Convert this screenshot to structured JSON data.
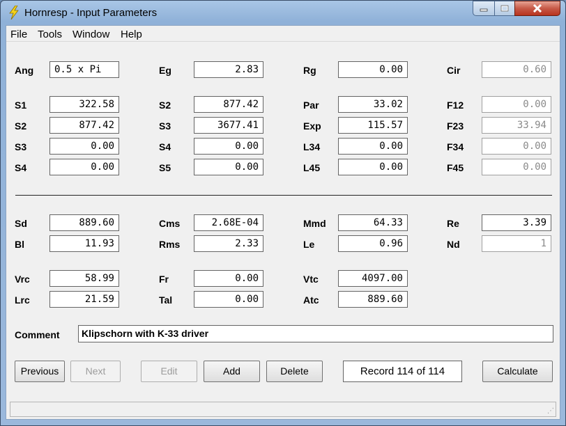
{
  "window": {
    "title": "Hornresp - Input Parameters"
  },
  "menu": {
    "file": "File",
    "tools": "Tools",
    "window": "Window",
    "help": "Help"
  },
  "fields": {
    "ang": {
      "label": "Ang",
      "value": "0.5 x Pi"
    },
    "eg": {
      "label": "Eg",
      "value": "2.83"
    },
    "rg": {
      "label": "Rg",
      "value": "0.00"
    },
    "cir": {
      "label": "Cir",
      "value": "0.60"
    },
    "s1": {
      "label": "S1",
      "value": "322.58"
    },
    "s2a": {
      "label": "S2",
      "value": "877.42"
    },
    "par": {
      "label": "Par",
      "value": "33.02"
    },
    "f12": {
      "label": "F12",
      "value": "0.00"
    },
    "s2b": {
      "label": "S2",
      "value": "877.42"
    },
    "s3a": {
      "label": "S3",
      "value": "3677.41"
    },
    "exp": {
      "label": "Exp",
      "value": "115.57"
    },
    "f23": {
      "label": "F23",
      "value": "33.94"
    },
    "s3b": {
      "label": "S3",
      "value": "0.00"
    },
    "s4a": {
      "label": "S4",
      "value": "0.00"
    },
    "l34": {
      "label": "L34",
      "value": "0.00"
    },
    "f34": {
      "label": "F34",
      "value": "0.00"
    },
    "s4b": {
      "label": "S4",
      "value": "0.00"
    },
    "s5": {
      "label": "S5",
      "value": "0.00"
    },
    "l45": {
      "label": "L45",
      "value": "0.00"
    },
    "f45": {
      "label": "F45",
      "value": "0.00"
    },
    "sd": {
      "label": "Sd",
      "value": "889.60"
    },
    "cms": {
      "label": "Cms",
      "value": "2.68E-04"
    },
    "mmd": {
      "label": "Mmd",
      "value": "64.33"
    },
    "re": {
      "label": "Re",
      "value": "3.39"
    },
    "bl": {
      "label": "Bl",
      "value": "11.93"
    },
    "rms": {
      "label": "Rms",
      "value": "2.33"
    },
    "le": {
      "label": "Le",
      "value": "0.96"
    },
    "nd": {
      "label": "Nd",
      "value": "1"
    },
    "vrc": {
      "label": "Vrc",
      "value": "58.99"
    },
    "fr": {
      "label": "Fr",
      "value": "0.00"
    },
    "vtc": {
      "label": "Vtc",
      "value": "4097.00"
    },
    "lrc": {
      "label": "Lrc",
      "value": "21.59"
    },
    "tal": {
      "label": "Tal",
      "value": "0.00"
    },
    "atc": {
      "label": "Atc",
      "value": "889.60"
    }
  },
  "comment": {
    "label": "Comment",
    "value": "Klipschorn with K-33 driver"
  },
  "buttons": {
    "previous": "Previous",
    "next": "Next",
    "edit": "Edit",
    "add": "Add",
    "delete": "Delete",
    "calculate": "Calculate"
  },
  "record": "Record 114 of 114",
  "icons": {
    "app": "lightning-bolt-icon",
    "minimize": "minimize-icon",
    "maximize": "maximize-icon",
    "close": "close-icon"
  }
}
